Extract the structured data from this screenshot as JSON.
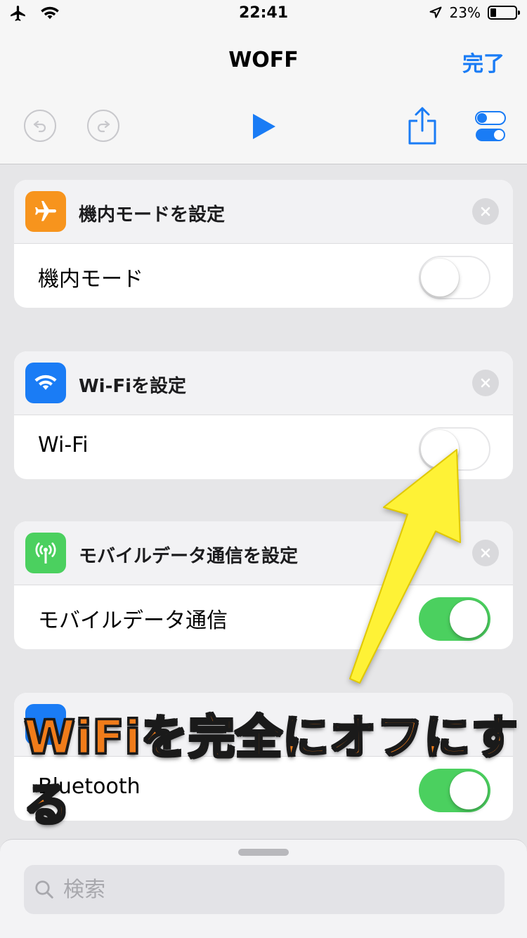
{
  "status_bar": {
    "time": "22:41",
    "battery": "23%"
  },
  "nav": {
    "title": "WOFF",
    "done_label": "完了"
  },
  "toolbar": {
    "icons": [
      "undo-icon",
      "redo-icon",
      "play-icon",
      "share-icon",
      "settings-toggle-icon"
    ],
    "accent": "#1a7cf5"
  },
  "cards": [
    {
      "title": "機内モードを設定",
      "label": "機内モード",
      "icon": "airplane-icon",
      "icon_color": "#f7941d",
      "toggle_on": false
    },
    {
      "title": "Wi-Fiを設定",
      "label": "Wi-Fi",
      "icon": "wifi-icon",
      "icon_color": "#1a7cf5",
      "toggle_on": false
    },
    {
      "title": "モバイルデータ通信を設定",
      "label": "モバイルデータ通信",
      "icon": "antenna-icon",
      "icon_color": "#4bd05f",
      "toggle_on": true
    },
    {
      "title": "",
      "label": "Bluetooth",
      "icon": "bluetooth-icon",
      "icon_color": "#1a7cf5",
      "toggle_on": true
    }
  ],
  "annotation": {
    "text": "WiFiを完全にオフにする",
    "text_color": "#f07c1a",
    "arrow_color": "#fef236"
  },
  "search": {
    "placeholder": "検索"
  }
}
